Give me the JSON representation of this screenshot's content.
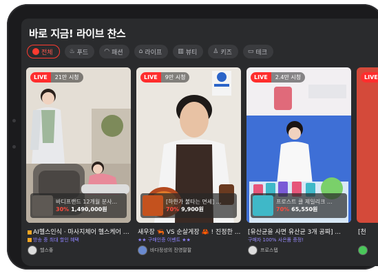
{
  "section": {
    "title": "바로 지금! 라이브 찬스"
  },
  "categories": [
    {
      "label": "전체",
      "icon": "live-dot-icon",
      "active": true
    },
    {
      "label": "푸드",
      "icon": "food-icon"
    },
    {
      "label": "패션",
      "icon": "fashion-icon"
    },
    {
      "label": "라이프",
      "icon": "life-icon"
    },
    {
      "label": "뷰티",
      "icon": "beauty-icon"
    },
    {
      "label": "키즈",
      "icon": "kids-icon"
    },
    {
      "label": "테크",
      "icon": "tech-icon"
    }
  ],
  "cards": [
    {
      "live": "LIVE",
      "viewers": "21만 시청",
      "product_name": "바디프랜드 12개월 분사...",
      "discount": "30%",
      "price": "1,490,000원",
      "title": "AI헬스인식 · 마사지체어 헬스케어 연세이즈 ...",
      "subtitle": "방송 중 최대 할인 혜택",
      "channel": "헬스좋",
      "colors": {
        "bg": "#d9d2c8"
      }
    },
    {
      "live": "LIVE",
      "viewers": "9만 시청",
      "product_name": "[하한가 불타는 면세] ...",
      "discount": "70%",
      "price": "9,900원",
      "title": "새우장 🦐 VS 순살게장 🦀 ! 진정한 ...",
      "subtitle": "★★ 구매인증 이벤트 ★★",
      "channel": "바다정성의 진영팔팔",
      "colors": {
        "bg": "#e8e4dd"
      }
    },
    {
      "live": "LIVE",
      "viewers": "2.4만 시청",
      "product_name": "프로스트 클 제일리크 ...",
      "discount": "70%",
      "price": "65,550원",
      "title": "[유산균을 사면 유산균 3개 공짜] ...",
      "subtitle": "구매자 100% 사은품 증정!",
      "channel": "프로스텝",
      "colors": {
        "bg": "#f0edf0"
      }
    },
    {
      "live": "LIVE",
      "viewers": "",
      "product_name": "",
      "discount": "",
      "price": "",
      "title": "[천",
      "subtitle": "",
      "channel": "",
      "colors": {
        "bg": "#d44a3a"
      }
    }
  ]
}
